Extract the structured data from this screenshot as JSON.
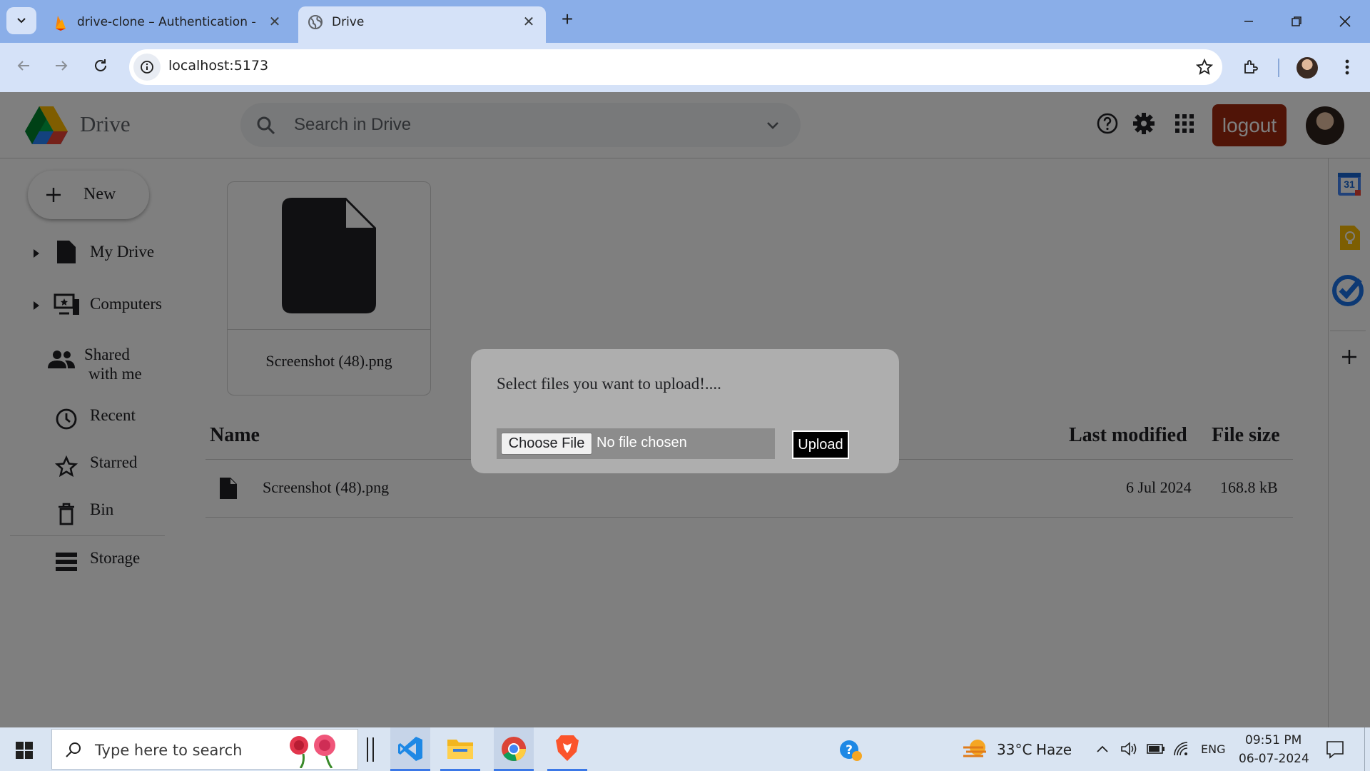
{
  "browser": {
    "tabs": [
      {
        "title": "drive-clone – Authentication – F",
        "active": false
      },
      {
        "title": "Drive",
        "active": true
      }
    ],
    "url": "localhost:5173"
  },
  "header": {
    "app_name": "Drive",
    "search_placeholder": "Search in Drive",
    "logout_label": "logout"
  },
  "sidebar": {
    "new_label": "New",
    "items": [
      {
        "label": "My Drive"
      },
      {
        "label": "Computers"
      },
      {
        "label": "Shared",
        "label2": "with me"
      },
      {
        "label": "Recent"
      },
      {
        "label": "Starred"
      },
      {
        "label": "Bin"
      },
      {
        "label": "Storage"
      }
    ]
  },
  "main": {
    "card_filename": "Screenshot (48).png",
    "columns": {
      "name": "Name",
      "modified": "Last modified",
      "size": "File size"
    },
    "rows": [
      {
        "name": "Screenshot (48).png",
        "modified": "6 Jul 2024",
        "size": "168.8 kB"
      }
    ]
  },
  "side_panel": {
    "calendar_day": "31"
  },
  "dialog": {
    "message": "Select files you want to upload!....",
    "choose_label": "Choose File",
    "no_file_label": "No file chosen",
    "upload_label": "Upload"
  },
  "taskbar": {
    "search_placeholder": "Type here to search",
    "weather_temp": "33°C",
    "weather_desc": "Haze",
    "language": "ENG",
    "time": "09:51 PM",
    "date": "06-07-2024"
  },
  "colors": {
    "tabstrip": "#8aaee8",
    "toolbar": "#d5e2f8",
    "logout": "#a0280f",
    "taskbar": "#d9e4f2"
  }
}
